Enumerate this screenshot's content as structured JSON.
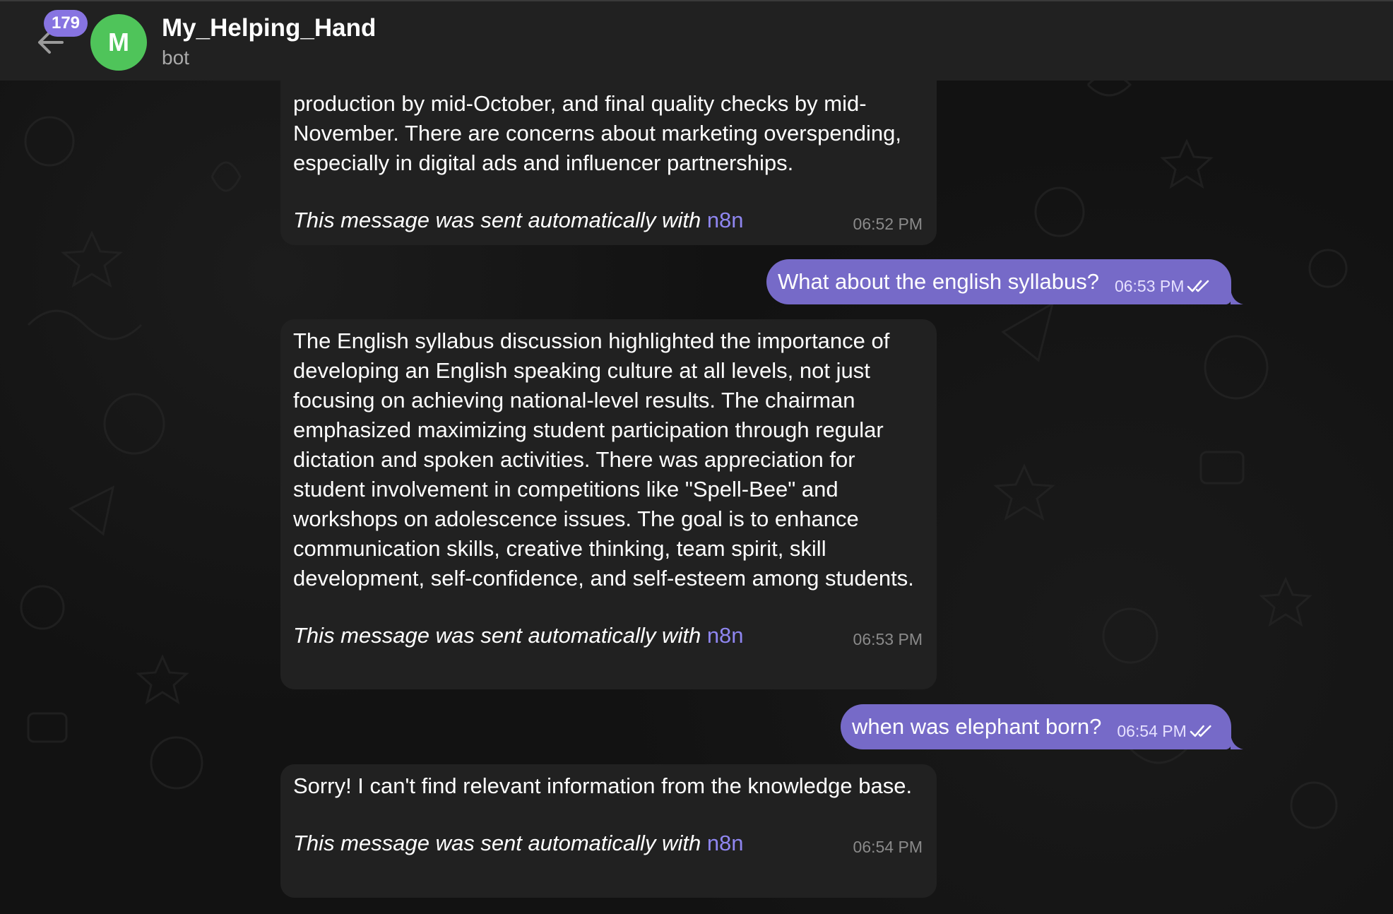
{
  "header": {
    "unread_count": "179",
    "avatar_letter": "M",
    "title": "My_Helping_Hand",
    "subtitle": "bot"
  },
  "messages": {
    "m1": {
      "line1": "production by mid-October, and final quality checks by mid-",
      "line2": "November. There are concerns about marketing overspending,",
      "line3": "especially in digital ads and influencer partnerships.",
      "auto_note": "This message was sent automatically with",
      "auto_link": "n8n",
      "time": "06:52 PM"
    },
    "m2": {
      "text": "What about the english syllabus?",
      "time": "06:53 PM"
    },
    "m3": {
      "text": "The English syllabus discussion highlighted the importance of developing an English speaking culture at all levels, not just focusing on achieving national-level results. The chairman emphasized maximizing student participation through regular dictation and spoken activities. There was appreciation for student involvement in competitions like \"Spell-Bee\" and workshops on adolescence issues. The goal is to enhance communication skills, creative thinking, team spirit, skill development, self-confidence, and self-esteem among students.",
      "auto_note": "This message was sent automatically with",
      "auto_link": "n8n",
      "time": "06:53 PM"
    },
    "m4": {
      "text": "when was elephant born?",
      "time": "06:54 PM"
    },
    "m5": {
      "text": "Sorry! I can't find relevant information from the knowledge base.",
      "auto_note": "This message was sent automatically with",
      "auto_link": "n8n",
      "time": "06:54 PM"
    }
  },
  "colors": {
    "accent": "#8774e1",
    "outgoing_bubble": "#766ac8",
    "incoming_bubble": "#212121",
    "avatar": "#4fc45a",
    "link": "#8f86f0"
  },
  "icons": {
    "back": "arrow-left-icon",
    "read_receipt": "double-check-icon"
  }
}
